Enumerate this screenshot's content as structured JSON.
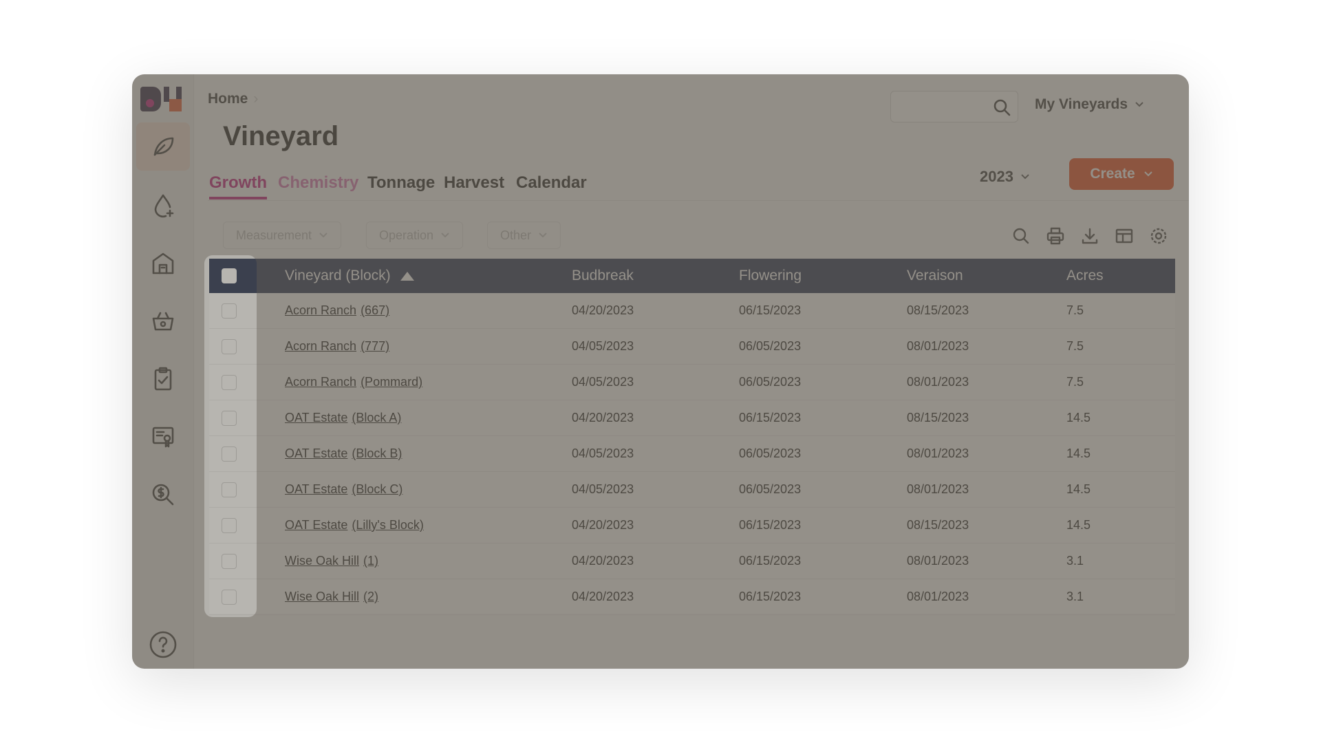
{
  "breadcrumb": {
    "home": "Home"
  },
  "page_title": "Vineyard",
  "search": {
    "placeholder": ""
  },
  "vineyard_selector": {
    "label": "My Vineyards"
  },
  "tabs": [
    {
      "label": "Growth",
      "state": "active"
    },
    {
      "label": "Chemistry",
      "state": "soft"
    },
    {
      "label": "Tonnage",
      "state": "normal"
    },
    {
      "label": "Harvest",
      "state": "normal"
    },
    {
      "label": "Calendar",
      "state": "normal"
    }
  ],
  "year_selector": {
    "value": "2023"
  },
  "create_button": {
    "label": "Create"
  },
  "filters": [
    {
      "label": "Measurement"
    },
    {
      "label": "Operation"
    },
    {
      "label": "Other"
    }
  ],
  "toolbar_icons": [
    "search-icon",
    "print-icon",
    "download-icon",
    "columns-icon",
    "settings-icon"
  ],
  "sidebar_icons": [
    "leaf-icon",
    "water-drop-icon",
    "winery-building-icon",
    "harvest-basket-icon",
    "clipboard-check-icon",
    "certificate-icon",
    "dollar-search-icon",
    "help-icon"
  ],
  "table": {
    "headers": {
      "vineyard": "Vineyard (Block)",
      "budbreak": "Budbreak",
      "flowering": "Flowering",
      "veraison": "Veraison",
      "acres": "Acres"
    },
    "rows": [
      {
        "vineyard": "Acorn Ranch",
        "block": "(667)",
        "budbreak": "04/20/2023",
        "flowering": "06/15/2023",
        "veraison": "08/15/2023",
        "acres": "7.5"
      },
      {
        "vineyard": "Acorn Ranch",
        "block": "(777)",
        "budbreak": "04/05/2023",
        "flowering": "06/05/2023",
        "veraison": "08/01/2023",
        "acres": "7.5"
      },
      {
        "vineyard": "Acorn Ranch",
        "block": "(Pommard)",
        "budbreak": "04/05/2023",
        "flowering": "06/05/2023",
        "veraison": "08/01/2023",
        "acres": "7.5"
      },
      {
        "vineyard": "OAT Estate",
        "block": "(Block A)",
        "budbreak": "04/20/2023",
        "flowering": "06/15/2023",
        "veraison": "08/15/2023",
        "acres": "14.5"
      },
      {
        "vineyard": "OAT Estate",
        "block": "(Block B)",
        "budbreak": "04/05/2023",
        "flowering": "06/05/2023",
        "veraison": "08/01/2023",
        "acres": "14.5"
      },
      {
        "vineyard": "OAT Estate",
        "block": "(Block C)",
        "budbreak": "04/05/2023",
        "flowering": "06/05/2023",
        "veraison": "08/01/2023",
        "acres": "14.5"
      },
      {
        "vineyard": "OAT Estate",
        "block": "(Lilly's Block)",
        "budbreak": "04/20/2023",
        "flowering": "06/15/2023",
        "veraison": "08/15/2023",
        "acres": "14.5"
      },
      {
        "vineyard": "Wise Oak Hill",
        "block": "(1)",
        "budbreak": "04/20/2023",
        "flowering": "06/15/2023",
        "veraison": "08/01/2023",
        "acres": "3.1"
      },
      {
        "vineyard": "Wise Oak Hill",
        "block": "(2)",
        "budbreak": "04/20/2023",
        "flowering": "06/15/2023",
        "veraison": "08/01/2023",
        "acres": "3.1"
      }
    ]
  },
  "colors": {
    "accent": "#c2167a",
    "create": "#e8471a",
    "table_header": "#1e2b4e"
  }
}
